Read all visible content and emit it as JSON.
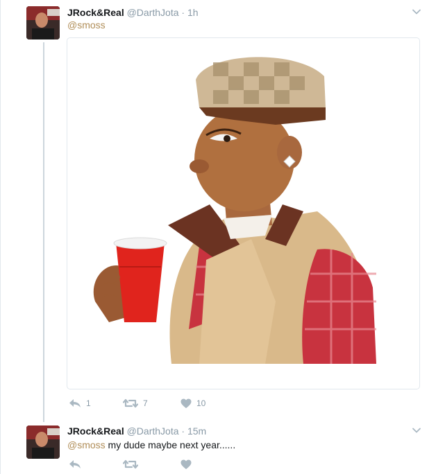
{
  "tweets": [
    {
      "name": "JRock&Real",
      "handle": "@DarthJota",
      "separator": "·",
      "time": "1h",
      "reply_to": "@smoss",
      "media_description": "emoji-style illustration of a man in a checkered cap and tan coat holding a red cup",
      "counts": {
        "replies": "1",
        "retweets": "7",
        "likes": "10"
      }
    },
    {
      "name": "JRock&Real",
      "handle": "@DarthJota",
      "separator": "·",
      "time": "15m",
      "mention": "@smoss",
      "text": " my dude maybe next year......"
    }
  ],
  "colors": {
    "mention": "#b08d57",
    "muted": "#8899a6",
    "thread_line": "#ccd6dd",
    "cup_red": "#e0241d"
  },
  "icons": [
    "reply-icon",
    "retweet-icon",
    "like-icon",
    "chevron-down-icon"
  ]
}
